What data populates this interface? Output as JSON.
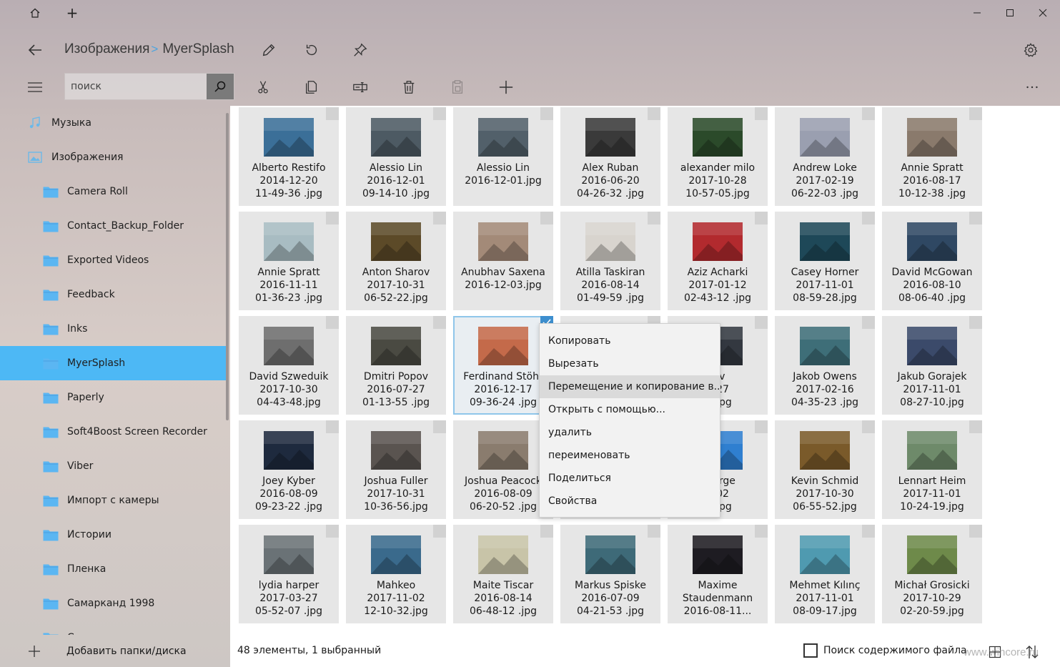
{
  "titlebar": {
    "new_tab_label": "+"
  },
  "breadcrumb": {
    "parent": "Изображения",
    "separator": ">",
    "current": "MyerSplash"
  },
  "search": {
    "placeholder": "поиск"
  },
  "sidebar": {
    "items": [
      {
        "label": "Музыка",
        "icon": "music-icon",
        "level": 0
      },
      {
        "label": "Изображения",
        "icon": "pictures-icon",
        "level": 0
      },
      {
        "label": "Camera Roll",
        "icon": "folder-icon",
        "level": 1
      },
      {
        "label": "Contact_Backup_Folder",
        "icon": "folder-icon",
        "level": 1
      },
      {
        "label": "Exported Videos",
        "icon": "folder-icon",
        "level": 1
      },
      {
        "label": "Feedback",
        "icon": "folder-icon",
        "level": 1
      },
      {
        "label": "Inks",
        "icon": "folder-icon",
        "level": 1
      },
      {
        "label": "MyerSplash",
        "icon": "folder-icon",
        "level": 1,
        "selected": true
      },
      {
        "label": "Paperly",
        "icon": "folder-icon",
        "level": 1
      },
      {
        "label": "Soft4Boost Screen Recorder",
        "icon": "folder-icon",
        "level": 1
      },
      {
        "label": "Viber",
        "icon": "folder-icon",
        "level": 1
      },
      {
        "label": "Импорт с камеры",
        "icon": "folder-icon",
        "level": 1
      },
      {
        "label": "Истории",
        "icon": "folder-icon",
        "level": 1
      },
      {
        "label": "Пленка",
        "icon": "folder-icon",
        "level": 1
      },
      {
        "label": "Самарканд 1998",
        "icon": "folder-icon",
        "level": 1
      },
      {
        "label": "Сканы",
        "icon": "folder-icon",
        "level": 1
      }
    ],
    "add_folder_label": "Добавить папки/диска"
  },
  "files": [
    {
      "line1": "Alberto Restifo",
      "line2": "2014-12-20",
      "line3": "11-49-36 .jpg",
      "thumb": "#3b6f98"
    },
    {
      "line1": "Alessio Lin",
      "line2": "2016-12-01",
      "line3": "09-14-10 .jpg",
      "thumb": "#4d5a63"
    },
    {
      "line1": "Alessio Lin",
      "line2": "2016-12-01.jpg",
      "line3": "",
      "thumb": "#52606a"
    },
    {
      "line1": "Alex Ruban",
      "line2": "2016-06-20",
      "line3": "04-26-32 .jpg",
      "thumb": "#3a3a3a"
    },
    {
      "line1": "alexander milo",
      "line2": "2017-10-28",
      "line3": "10-57-05.jpg",
      "thumb": "#2b4a2a"
    },
    {
      "line1": "Andrew Loke",
      "line2": "2017-02-19",
      "line3": "06-22-03 .jpg",
      "thumb": "#9a9fb0"
    },
    {
      "line1": "Annie Spratt",
      "line2": "2016-08-17",
      "line3": "10-12-38 .jpg",
      "thumb": "#8a7a6c"
    },
    {
      "line1": "Annie Spratt",
      "line2": "2016-11-11",
      "line3": "01-36-23 .jpg",
      "thumb": "#a8bcc2"
    },
    {
      "line1": "Anton Sharov",
      "line2": "2017-10-31",
      "line3": "06-52-22.jpg",
      "thumb": "#5c4a28"
    },
    {
      "line1": "Anubhav Saxena",
      "line2": "2016-12-03.jpg",
      "line3": "",
      "thumb": "#a38a78"
    },
    {
      "line1": "Atilla Taskiran",
      "line2": "2016-08-14",
      "line3": "01-49-59 .jpg",
      "thumb": "#d8d4ce"
    },
    {
      "line1": "Aziz Acharki",
      "line2": "2017-01-12",
      "line3": "02-43-12 .jpg",
      "thumb": "#b22a2e"
    },
    {
      "line1": "Casey Horner",
      "line2": "2017-11-01",
      "line3": "08-59-28.jpg",
      "thumb": "#1e4858"
    },
    {
      "line1": "David McGowan",
      "line2": "2016-08-10",
      "line3": "08-06-40 .jpg",
      "thumb": "#2f4863"
    },
    {
      "line1": "David Szweduik",
      "line2": "2017-10-30",
      "line3": "04-43-48.jpg",
      "thumb": "#6e6e6e"
    },
    {
      "line1": "Dmitri  Popov",
      "line2": "2016-07-27",
      "line3": "01-13-55 .jpg",
      "thumb": "#4a4a42"
    },
    {
      "line1": "Ferdinand Stöhr",
      "line2": "2016-12-17",
      "line3": "09-36-24 .jpg",
      "thumb": "#c46a4a",
      "selected": true
    },
    {
      "line1": "",
      "line2": "",
      "line3": "",
      "thumb": "#3a3a3a"
    },
    {
      "line1": "lov",
      "line2": "4-27",
      "line3": "9 .jpg",
      "thumb": "#333840"
    },
    {
      "line1": "Jakob Owens",
      "line2": "2017-02-16",
      "line3": "04-35-23 .jpg",
      "thumb": "#3e6e78"
    },
    {
      "line1": "Jakub Gorajek",
      "line2": "2017-11-01",
      "line3": "08-27-10.jpg",
      "thumb": "#3b4a6a"
    },
    {
      "line1": "Joey Kyber",
      "line2": "2016-08-09",
      "line3": "09-23-22 .jpg",
      "thumb": "#1e2a3e"
    },
    {
      "line1": "Joshua Fuller",
      "line2": "2017-10-31",
      "line3": "10-36-56.jpg",
      "thumb": "#5a5450"
    },
    {
      "line1": "Joshua Peacock",
      "line2": "2016-08-09",
      "line3": "06-20-52 .jpg",
      "thumb": "#8a7c6e"
    },
    {
      "line1": "",
      "line2": "",
      "line3": "",
      "thumb": "#cccccc"
    },
    {
      "line1": "aBerge",
      "line2": "2-02",
      "line3": "7 .jpg",
      "thumb": "#2f7fd0"
    },
    {
      "line1": "Kevin Schmid",
      "line2": "2017-10-30",
      "line3": "06-55-52.jpg",
      "thumb": "#7a5a2a"
    },
    {
      "line1": "Lennart Heim",
      "line2": "2017-11-01",
      "line3": "10-24-19.jpg",
      "thumb": "#6e8a6a"
    },
    {
      "line1": "lydia harper",
      "line2": "2017-03-27",
      "line3": "05-52-07 .jpg",
      "thumb": "#6a7276"
    },
    {
      "line1": "Mahkeo",
      "line2": "2017-11-02",
      "line3": "12-10-32.jpg",
      "thumb": "#3a6a8c"
    },
    {
      "line1": "Maite Tiscar",
      "line2": "2016-08-14",
      "line3": "06-48-12 .jpg",
      "thumb": "#c8c4a8"
    },
    {
      "line1": "Markus Spiske",
      "line2": "2016-07-09",
      "line3": "04-21-53 .jpg",
      "thumb": "#3e6a78"
    },
    {
      "line1": "Maxime",
      "line2": "Staudenmann",
      "line3": "2016-08-11...",
      "thumb": "#1e1c22"
    },
    {
      "line1": "Mehmet  Kılınç",
      "line2": "2017-11-01",
      "line3": "08-09-17.jpg",
      "thumb": "#4f9ab0"
    },
    {
      "line1": "Michał Grosicki",
      "line2": "2017-10-29",
      "line3": "02-20-59.jpg",
      "thumb": "#6e8a4a"
    }
  ],
  "context_menu": {
    "items": [
      {
        "label": "Копировать"
      },
      {
        "label": "Вырезать"
      },
      {
        "label": "Перемещение и копирование в...",
        "hover": true
      },
      {
        "label": "Открыть с помощью..."
      },
      {
        "label": "удалить"
      },
      {
        "label": "переименовать"
      },
      {
        "label": "Поделиться"
      },
      {
        "label": "Свойства"
      }
    ]
  },
  "status": {
    "count_text": "48 элементы, 1 выбранный",
    "search_content_label": "Поиск содержимого файла"
  },
  "watermark": "www.wincore.ru",
  "colors": {
    "accent": "#4db8f5",
    "folder": "#5bb6f2",
    "selection_border": "#8fc6ea"
  }
}
